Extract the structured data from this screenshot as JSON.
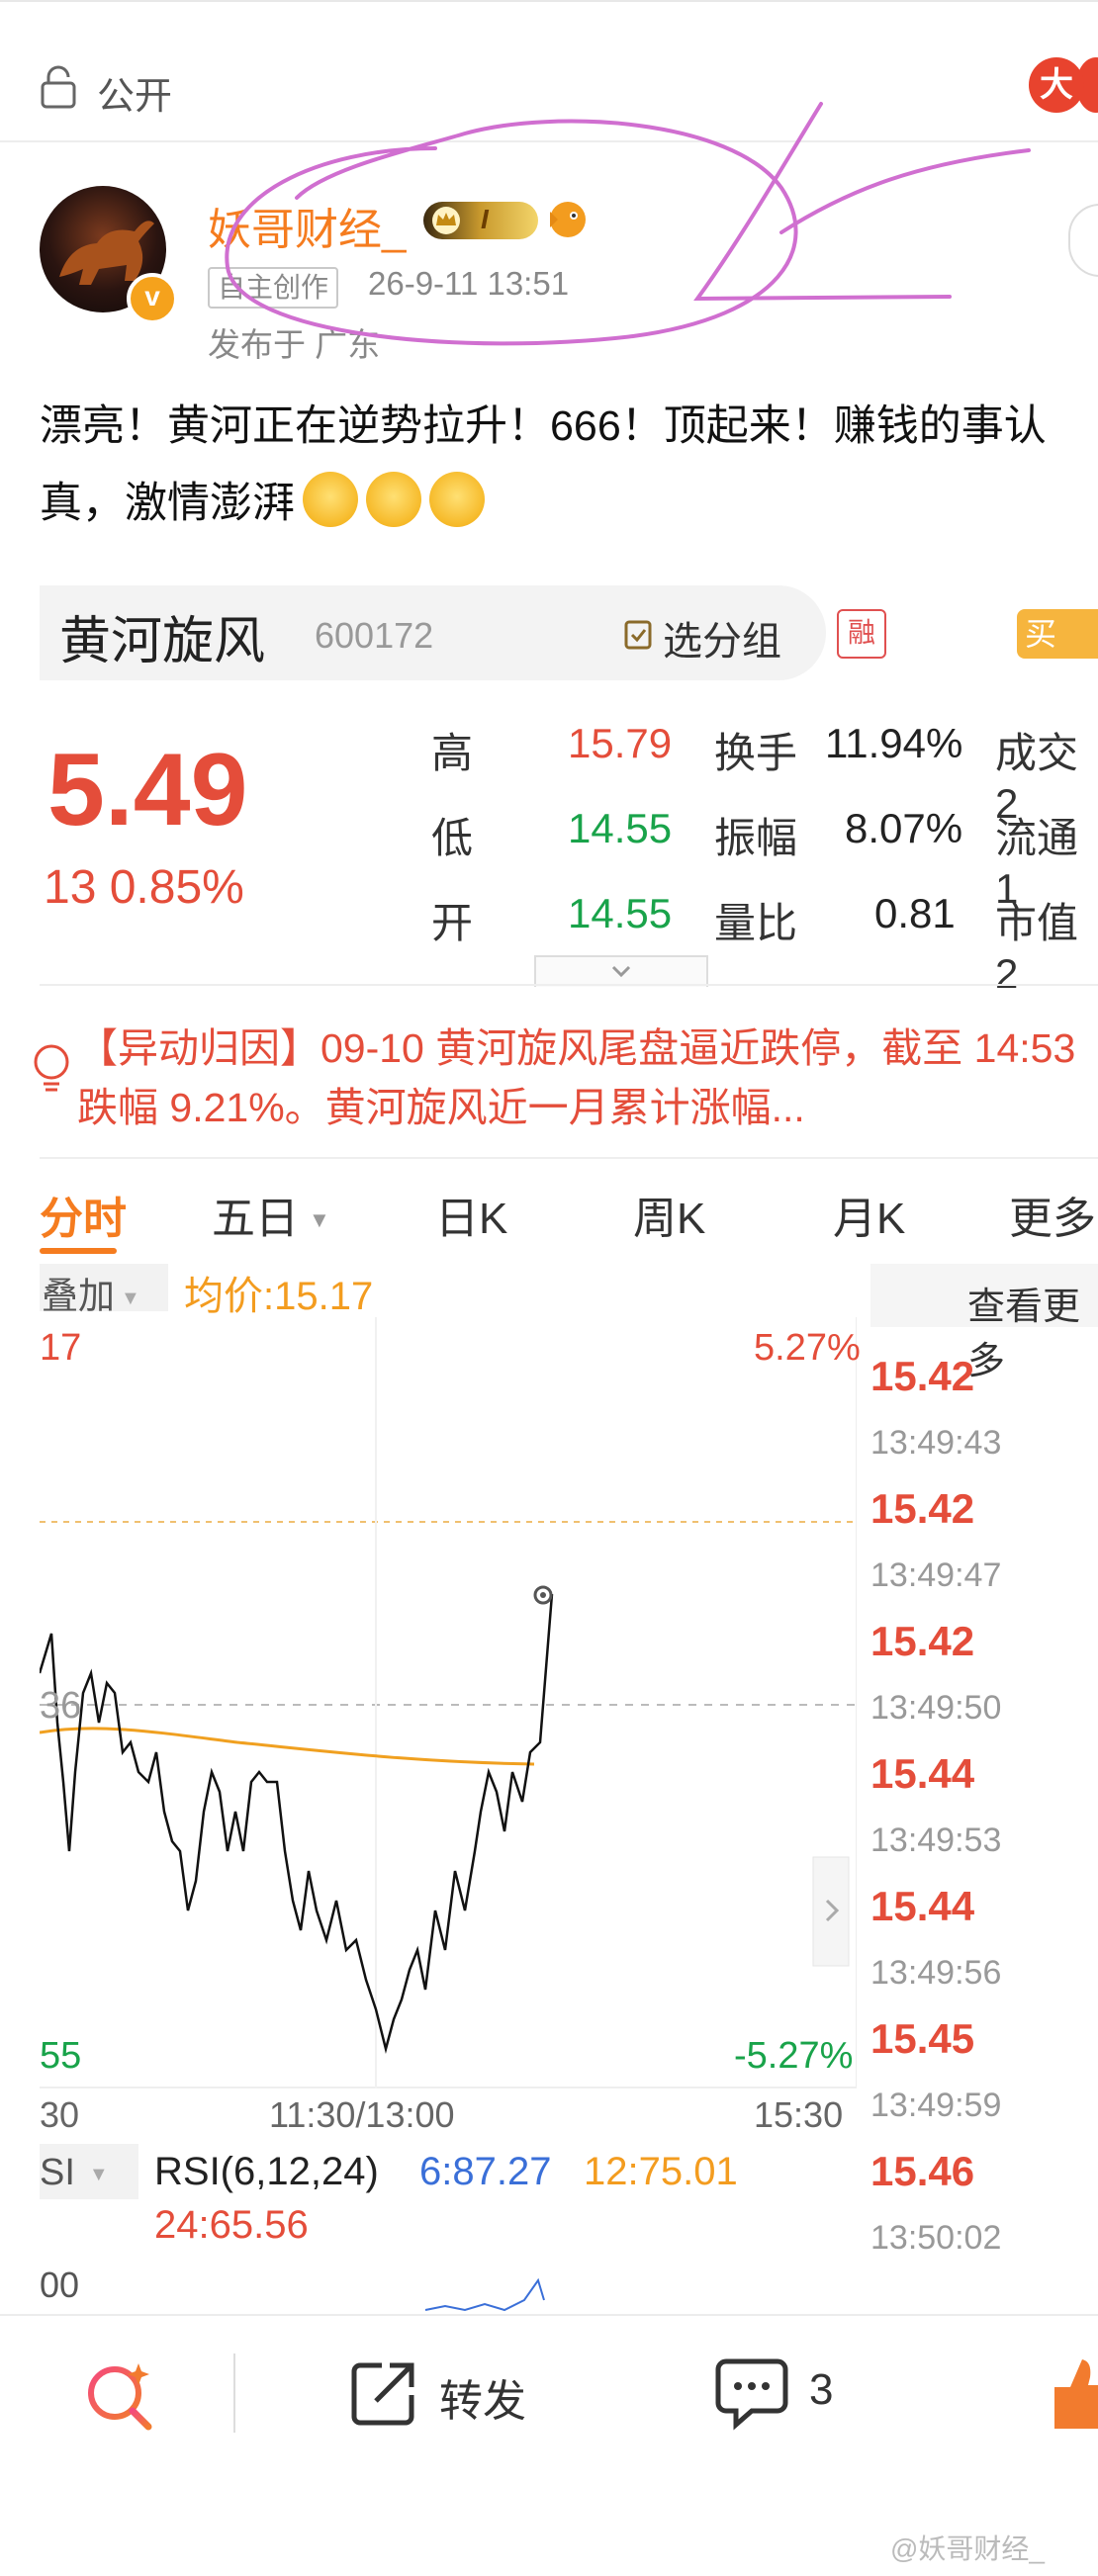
{
  "topbar": {
    "visibility_label": "公开",
    "badge_char": "大"
  },
  "author": {
    "name": "妖哥财经_",
    "vip_level": "I",
    "original_tag": "自主创作",
    "time": "26-9-11 13:51",
    "location": "发布于 广东"
  },
  "post": {
    "text": "漂亮！黄河正在逆势拉升！666！顶起来！赚钱的事认真，激情澎湃"
  },
  "stock": {
    "name": "黄河旋风",
    "code": "600172",
    "group_button": "选分组",
    "rong_tag": "融",
    "buy_tag": "买",
    "price": "5.49",
    "change": "13 0.85%",
    "quote": {
      "high_label": "高",
      "high": "15.79",
      "low_label": "低",
      "low": "14.55",
      "open_label": "开",
      "open": "14.55",
      "turnover_label": "换手",
      "turnover": "11.94%",
      "amplitude_label": "振幅",
      "amplitude": "8.07%",
      "volratio_label": "量比",
      "volratio": "0.81",
      "c4_r1": "成交2",
      "c4_r2": "流通1",
      "c4_r3": "市值2"
    },
    "anomaly": "【异动归因】09-10 黄河旋风尾盘逼近跌停，截至 14:53 跌幅 9.21%。黄河旋风近一月累计涨幅..."
  },
  "tabs": [
    "分时",
    "五日",
    "日K",
    "周K",
    "月K",
    "更多"
  ],
  "chart": {
    "overlay_label": "叠加",
    "avg_label": "均价:15.17",
    "view_more": "查看更多",
    "pct_top": "5.27%",
    "pct_bottom": "-5.27%",
    "left_top": "17",
    "left_mid": "36",
    "left_bottom": "55",
    "time_left": "30",
    "time_mid": "11:30/13:00",
    "time_right": "15:30"
  },
  "ticks": [
    {
      "price": "15.42",
      "time": "13:49:43"
    },
    {
      "price": "15.42",
      "time": "13:49:47"
    },
    {
      "price": "15.42",
      "time": "13:49:50"
    },
    {
      "price": "15.44",
      "time": "13:49:53"
    },
    {
      "price": "15.44",
      "time": "13:49:56"
    },
    {
      "price": "15.45",
      "time": "13:49:59"
    },
    {
      "price": "15.46",
      "time": "13:50:02"
    }
  ],
  "rsi": {
    "name": "SI",
    "label": "RSI(6,12,24)",
    "v6": "6:87.27",
    "v12": "12:75.01",
    "v24": "24:65.56",
    "axis": "00"
  },
  "actions": {
    "repost": "转发",
    "comments": "3"
  },
  "watermark": "@妖哥财经_",
  "colors": {
    "up": "#e44d3a",
    "down": "#19a34a",
    "accent": "#f57c1f",
    "avg_line": "#f39c1f"
  }
}
